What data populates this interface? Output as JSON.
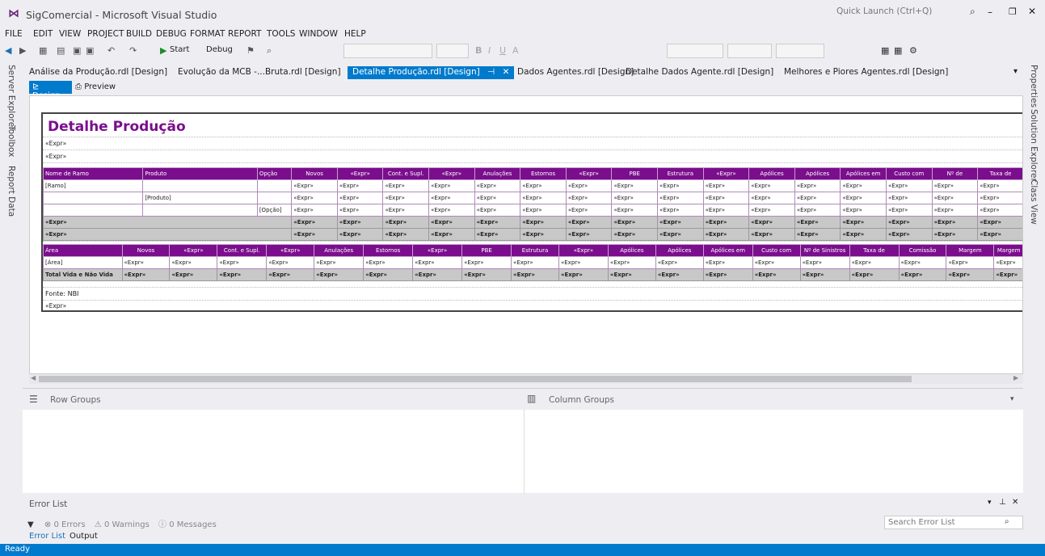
{
  "window": {
    "title": "SigComercial - Microsoft Visual Studio",
    "quick_launch": "Quick Launch (Ctrl+Q)"
  },
  "menu": [
    "FILE",
    "EDIT",
    "VIEW",
    "PROJECT",
    "BUILD",
    "DEBUG",
    "FORMAT",
    "REPORT",
    "TOOLS",
    "WINDOW",
    "HELP"
  ],
  "toolbar": {
    "start_label": "Start",
    "config": "Debug"
  },
  "side_left": [
    "Server Explorer",
    "Toolbox",
    "Report Data"
  ],
  "side_right": [
    "Properties",
    "Solution Explorer",
    "Class View"
  ],
  "tabs": [
    "Análise da Produção.rdl [Design]",
    "Evolução da MCB -...Bruta.rdl [Design]",
    "Detalhe Produção.rdl [Design]",
    "Dados Agentes.rdl [Design]",
    "Detalhe Dados Agente.rdl [Design]",
    "Melhores e Piores Agentes.rdl [Design]"
  ],
  "subtabs": {
    "design": "Design",
    "preview": "Preview"
  },
  "report": {
    "title": "Detalhe Produção",
    "expr": "«Expr»",
    "table1_headers": [
      "Nome de Ramo",
      "Produto",
      "Opção",
      "Novos",
      "«Expr»",
      "Cont. e Supl.",
      "«Expr»",
      "Anulações",
      "Estornos",
      "«Expr»",
      "PBE",
      "Estrutura",
      "«Expr»",
      "Apólices",
      "Apólices",
      "Apólices em",
      "Custo com",
      "Nº de",
      "Taxa de"
    ],
    "ramo": "[Ramo]",
    "produto": "[Produto]",
    "opcao": "[Opção]",
    "table2_headers": [
      "Área",
      "Novos",
      "«Expr»",
      "Cont. e Supl.",
      "«Expr»",
      "Anulações",
      "Estornos",
      "«Expr»",
      "PBE",
      "Estrutura",
      "«Expr»",
      "Apólices",
      "Apólices",
      "Apólices em",
      "Custo com",
      "Nº de Sinistros",
      "Taxa de",
      "Comissão",
      "Margem",
      "Margem"
    ],
    "area": "[Área]",
    "total_label": "Total Vida e Não Vida",
    "fonte": "Fonte: NBI"
  },
  "groups": {
    "row": "Row Groups",
    "column": "Column Groups"
  },
  "error_list": {
    "title": "Error List",
    "errors": "0 Errors",
    "warnings": "0 Warnings",
    "messages": "0 Messages",
    "search": "Search Error List",
    "tab_error": "Error List",
    "tab_output": "Output"
  },
  "status": "Ready",
  "colors": {
    "accent": "#007acc",
    "report_purple": "#7a0e8c"
  }
}
